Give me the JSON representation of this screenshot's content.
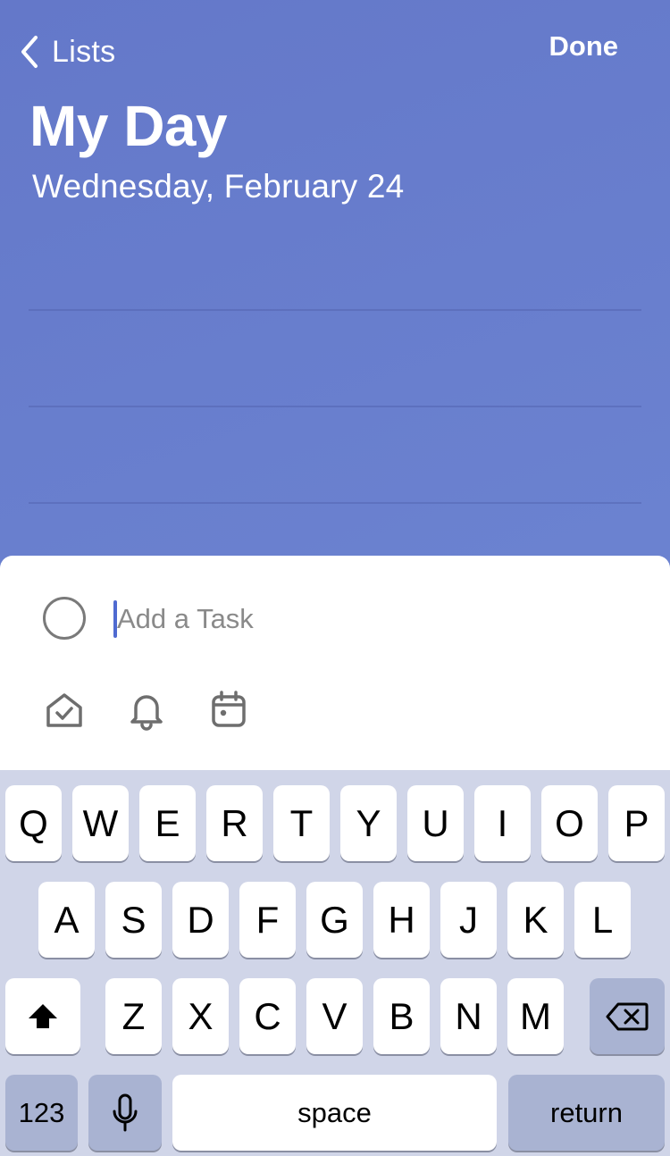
{
  "header": {
    "back_label": "Lists",
    "done_label": "Done",
    "title": "My Day",
    "date": "Wednesday, February 24"
  },
  "task_entry": {
    "placeholder": "Add a Task",
    "value": ""
  },
  "task_tools": [
    {
      "icon": "my-day-icon"
    },
    {
      "icon": "bell-icon"
    },
    {
      "icon": "calendar-icon"
    }
  ],
  "keyboard": {
    "row1": [
      "Q",
      "W",
      "E",
      "R",
      "T",
      "Y",
      "U",
      "I",
      "O",
      "P"
    ],
    "row2": [
      "A",
      "S",
      "D",
      "F",
      "G",
      "H",
      "J",
      "K",
      "L"
    ],
    "row3": [
      "Z",
      "X",
      "C",
      "V",
      "B",
      "N",
      "M"
    ],
    "numbers_label": "123",
    "space_label": "space",
    "return_label": "return",
    "shift_icon": "shift-icon",
    "delete_icon": "delete-icon",
    "mic_icon": "microphone-icon"
  },
  "colors": {
    "background": "#6a7fcc",
    "accent": "#4f6ad1",
    "keyboard": "#d0d5e8",
    "special_key": "#a9b3d2"
  }
}
